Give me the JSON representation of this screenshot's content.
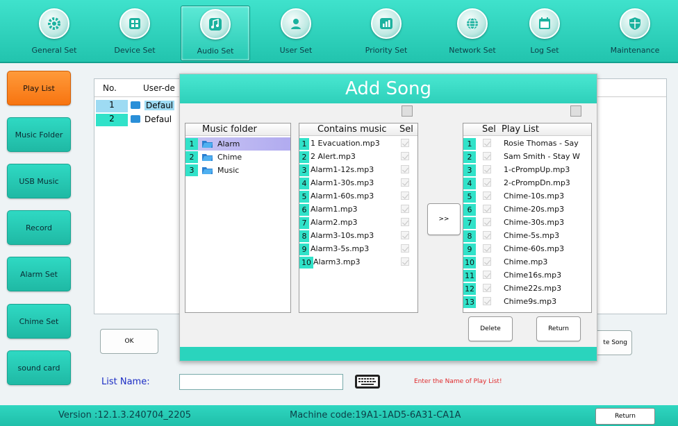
{
  "nav": {
    "items": [
      {
        "label": "General Set",
        "icon": "gear-icon"
      },
      {
        "label": "Device Set",
        "icon": "device-icon"
      },
      {
        "label": "Audio Set",
        "icon": "music-note-icon"
      },
      {
        "label": "User Set",
        "icon": "user-icon"
      },
      {
        "label": "Priority Set",
        "icon": "bar-chart-icon"
      },
      {
        "label": "Network Set",
        "icon": "globe-icon"
      },
      {
        "label": "Log  Set",
        "icon": "calendar-icon"
      },
      {
        "label": "Maintenance",
        "icon": "shield-icon"
      }
    ],
    "active": "Audio Set"
  },
  "sidebar": {
    "items": [
      "Play List",
      "Music Folder",
      "USB Music",
      "Record",
      "Alarm Set",
      "Chime Set",
      "sound card"
    ],
    "active": "Play List"
  },
  "background": {
    "table_headers": [
      "No.",
      "User-de"
    ],
    "rows": [
      {
        "no": "1",
        "name": "Defaul"
      },
      {
        "no": "2",
        "name": "Defaul"
      }
    ],
    "ok_label": "OK",
    "delete_label": "te Song",
    "list_name_label": "List Name:",
    "list_name_value": "",
    "hint": "Enter the Name of Play List!"
  },
  "dialog": {
    "title": "Add Song",
    "folders": {
      "header": "Music folder",
      "items": [
        {
          "no": "1",
          "name": "Alarm"
        },
        {
          "no": "2",
          "name": "Chime"
        },
        {
          "no": "3",
          "name": "Music"
        }
      ]
    },
    "contains": {
      "header": "Contains music",
      "sel_header": "Sel",
      "items": [
        {
          "no": "1",
          "name": "1 Evacuation.mp3"
        },
        {
          "no": "2",
          "name": "2 Alert.mp3"
        },
        {
          "no": "3",
          "name": "Alarm1-12s.mp3"
        },
        {
          "no": "4",
          "name": "Alarm1-30s.mp3"
        },
        {
          "no": "5",
          "name": "Alarm1-60s.mp3"
        },
        {
          "no": "6",
          "name": "Alarm1.mp3"
        },
        {
          "no": "7",
          "name": "Alarm2.mp3"
        },
        {
          "no": "8",
          "name": "Alarm3-10s.mp3"
        },
        {
          "no": "9",
          "name": "Alarm3-5s.mp3"
        },
        {
          "no": "10",
          "name": "Alarm3.mp3"
        }
      ]
    },
    "add_button": ">>",
    "playlist": {
      "sel_header": "Sel",
      "header": "Play List",
      "items": [
        {
          "no": "1",
          "name": "Rosie Thomas - Say"
        },
        {
          "no": "2",
          "name": "Sam Smith - Stay W"
        },
        {
          "no": "3",
          "name": "1-cPrompUp.mp3"
        },
        {
          "no": "4",
          "name": "2-cPrompDn.mp3"
        },
        {
          "no": "5",
          "name": "Chime-10s.mp3"
        },
        {
          "no": "6",
          "name": "Chime-20s.mp3"
        },
        {
          "no": "7",
          "name": "Chime-30s.mp3"
        },
        {
          "no": "8",
          "name": "Chime-5s.mp3"
        },
        {
          "no": "9",
          "name": "Chime-60s.mp3"
        },
        {
          "no": "10",
          "name": "Chime.mp3"
        },
        {
          "no": "11",
          "name": "Chime16s.mp3"
        },
        {
          "no": "12",
          "name": "Chime22s.mp3"
        },
        {
          "no": "13",
          "name": "Chime9s.mp3"
        }
      ]
    },
    "delete_label": "Delete",
    "return_label": "Return"
  },
  "footer": {
    "version": "Version :12.1.3.240704_2205",
    "machine_code": "Machine code:19A1-1AD5-6A31-CA1A",
    "return_label": "Return"
  },
  "colors": {
    "accent": "#2ed0ba",
    "active_orange": "#f77410",
    "row_number": "#31e2c9",
    "hint_red": "#e0282a"
  }
}
